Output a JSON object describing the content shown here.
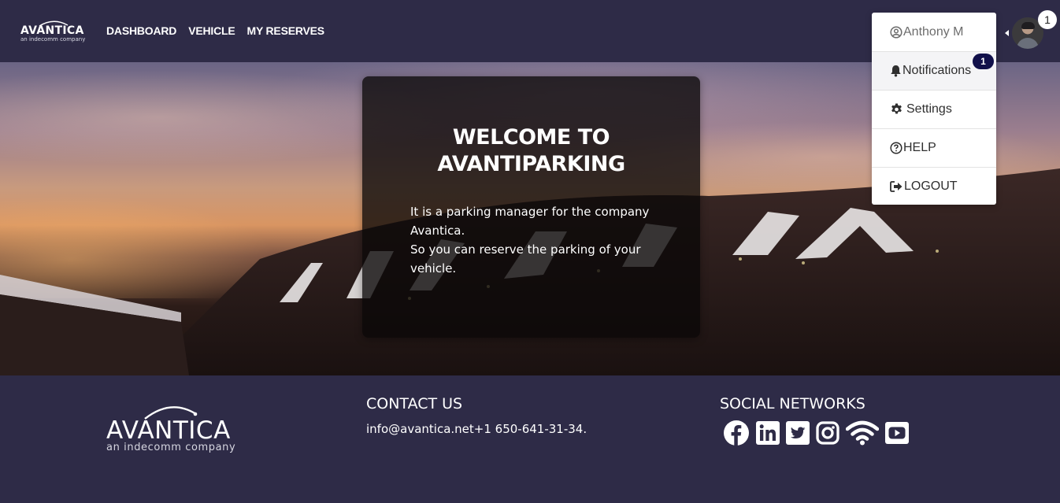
{
  "brand": {
    "name": "AVANTICA",
    "tagline": "an indecomm company"
  },
  "nav": {
    "items": [
      {
        "label": "DASHBOARD"
      },
      {
        "label": "VEHICLE"
      },
      {
        "label": "MY RESERVES"
      }
    ]
  },
  "user": {
    "avatar_badge": "1"
  },
  "dropdown": {
    "user_name": "Anthony M",
    "notifications_label": "Notifications",
    "notifications_count": "1",
    "settings_label": "Settings",
    "help_label": "HELP",
    "logout_label": "LOGOUT"
  },
  "welcome": {
    "title_line1": "WELCOME TO",
    "title_line2": "AVANTIPARKING",
    "body_line1": "It is a parking manager for the company",
    "body_line2": "Avantica.",
    "body_line3": "So you can reserve the parking of your",
    "body_line4": "vehicle."
  },
  "footer": {
    "contact_heading": "CONTACT US",
    "contact_info": "info@avantica.net+1 650-641-31-34.",
    "social_heading": "SOCIAL NETWORKS",
    "social_icons": [
      "facebook-icon",
      "linkedin-icon",
      "twitter-icon",
      "instagram-icon",
      "wifi-icon",
      "youtube-icon"
    ]
  },
  "colors": {
    "header_bg": "#2e2b47",
    "badge_bg": "#11104a"
  }
}
